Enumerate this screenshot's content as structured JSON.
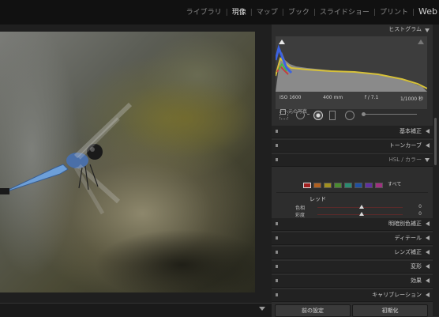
{
  "modules": {
    "library": "ライブラリ",
    "develop": "現像",
    "map": "マップ",
    "book": "ブック",
    "slideshow": "スライドショー",
    "print": "プリント",
    "web": "Web"
  },
  "histogram": {
    "title": "ヒストグラム",
    "iso": "ISO 1600",
    "focal": "400 mm",
    "aperture": "f / 7.1",
    "shutter": "1/1000 秒",
    "original_photo": "元の写真"
  },
  "sections": {
    "basic": "基本補正",
    "tone_curve": "トーンカーブ",
    "hsl": "HSL / カラー",
    "split_toning": "明暗別色補正",
    "detail": "ディテール",
    "lens": "レンズ補正",
    "transform": "変形",
    "effects": "効果",
    "calibration": "キャリブレーション"
  },
  "hsl": {
    "all_label": "すべて",
    "selected_color": "レッド",
    "sliders": [
      {
        "label": "色相",
        "value": "0"
      },
      {
        "label": "彩度",
        "value": "0"
      },
      {
        "label": "輝度",
        "value": "0"
      }
    ],
    "color_chips": [
      "#a02020",
      "#b06020",
      "#a09020",
      "#4a8a30",
      "#2a8a70",
      "#2050a0",
      "#6030a0",
      "#a03080"
    ]
  },
  "buttons": {
    "previous": "前の設定",
    "reset": "初期化"
  }
}
